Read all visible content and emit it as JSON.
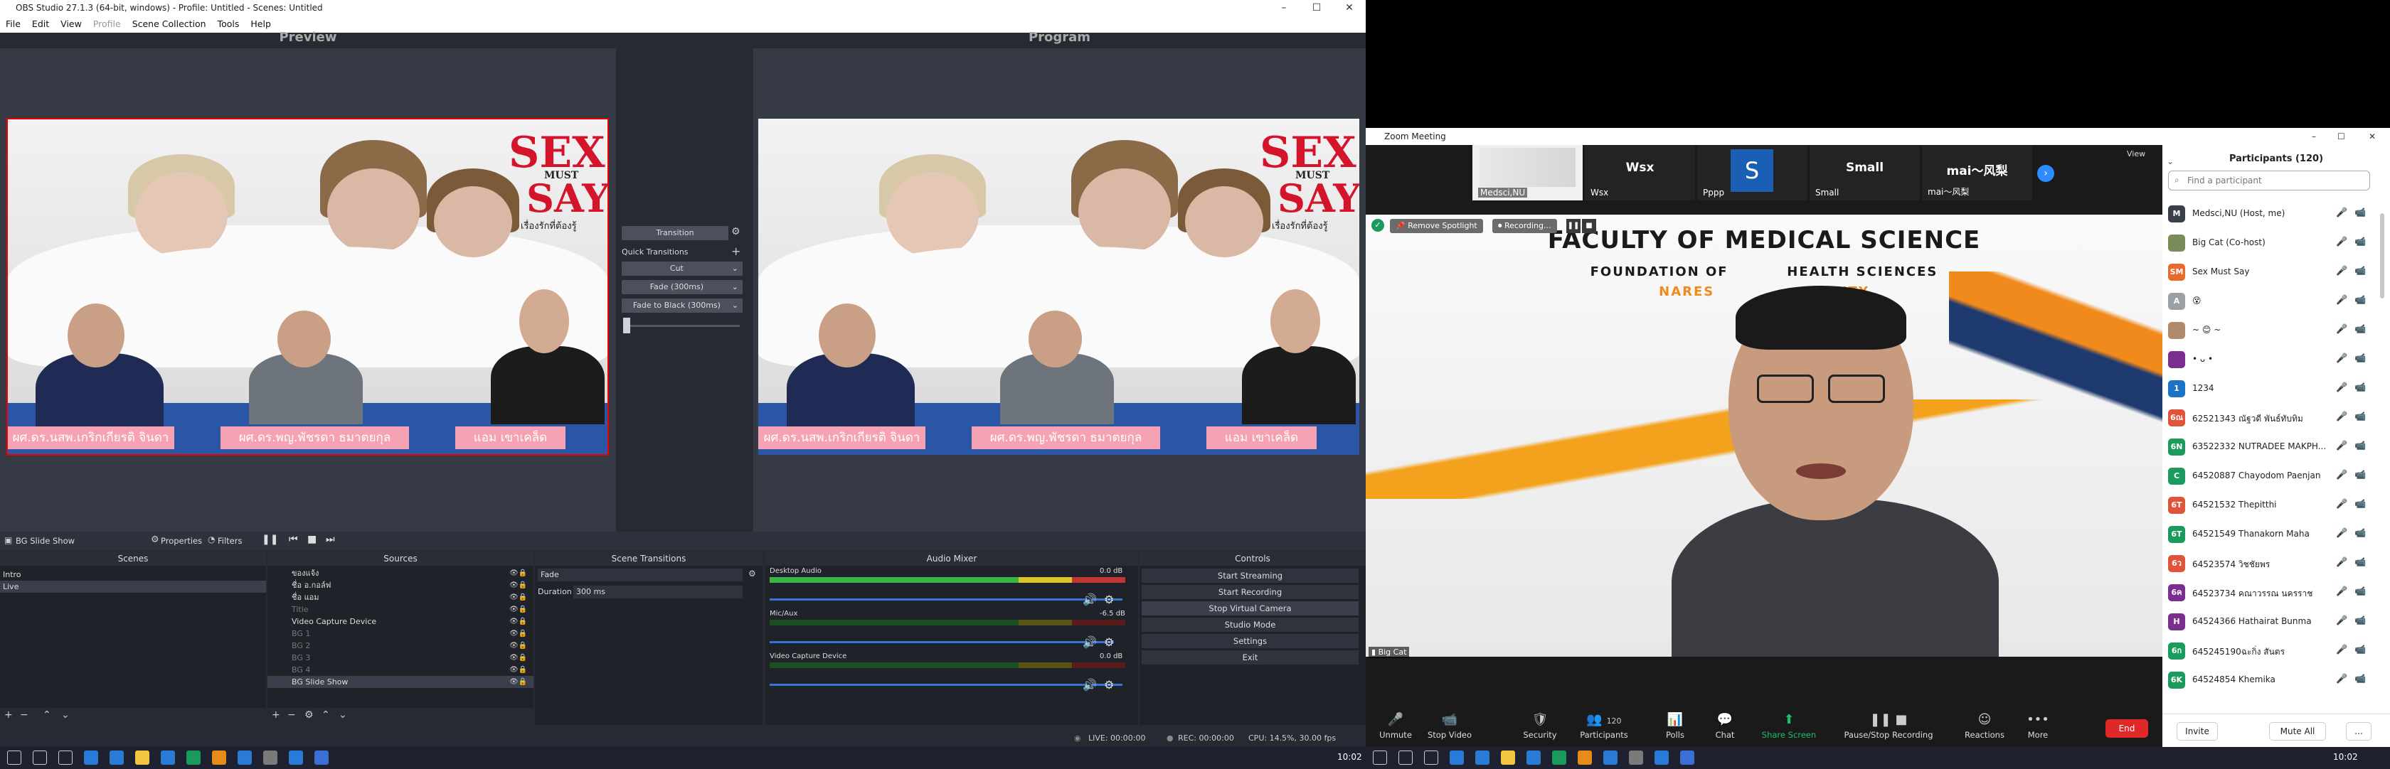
{
  "obs": {
    "title": "OBS Studio 27.1.3 (64-bit, windows) - Profile: Untitled - Scenes: Untitled",
    "menu": [
      "File",
      "Edit",
      "View",
      "Profile",
      "Scene Collection",
      "Tools",
      "Help"
    ],
    "preview_label": "Preview",
    "program_label": "Program",
    "scene_logo": {
      "line1": "SEX",
      "line2": "MUST",
      "line3": "SAY",
      "tagline": "เรื่องรักที่ต้องรู้"
    },
    "name_plates": [
      "ผศ.ดร.นสพ.เกริกเกียรติ จินดา",
      "ผศ.ดร.พญ.พัชรดา ธมาตยกุล",
      "แอม เขาเคล็ด"
    ],
    "transition": {
      "button": "Transition",
      "quick_label": "Quick Transitions",
      "options": [
        "Cut",
        "Fade (300ms)",
        "Fade to Black (300ms)"
      ]
    },
    "source_toolbar": {
      "source": "BG Slide Show",
      "properties": "Properties",
      "filters": "Filters"
    },
    "docks": {
      "scenes": {
        "title": "Scenes",
        "items": [
          "Intro",
          "Live"
        ],
        "selected": 1
      },
      "sources": {
        "title": "Sources",
        "items": [
          "ของแจ้ง",
          "ชื่อ อ.กอล์ฟ",
          "ชื่อ แอม",
          "Title",
          "Video Capture Device",
          "BG 1",
          "BG 2",
          "BG 3",
          "BG 4",
          "BG Slide Show"
        ]
      },
      "transitions": {
        "title": "Scene Transitions",
        "selected": "Fade",
        "duration_label": "Duration",
        "duration": "300 ms"
      },
      "mixer": {
        "title": "Audio Mixer",
        "channels": [
          {
            "name": "Desktop Audio",
            "db": "0.0 dB",
            "level": 0.78,
            "volume": 0.98
          },
          {
            "name": "Mic/Aux",
            "db": "-6.5 dB",
            "level": 0.0,
            "volume": 0.95
          },
          {
            "name": "Video Capture Device",
            "db": "0.0 dB",
            "level": 0.0,
            "volume": 0.98
          }
        ]
      },
      "controls": {
        "title": "Controls",
        "buttons": [
          "Start Streaming",
          "Start Recording",
          "Stop Virtual Camera",
          "Studio Mode",
          "Settings",
          "Exit"
        ]
      }
    },
    "status": {
      "live": "LIVE: 00:00:00",
      "rec": "REC: 00:00:00",
      "cpu": "CPU: 14.5%, 30.00 fps"
    }
  },
  "zoom": {
    "title": "Zoom Meeting",
    "view_label": "View",
    "tiles": [
      {
        "name": "Medsci,NU",
        "big": ""
      },
      {
        "name": "Wsx",
        "big": "Wsx"
      },
      {
        "name": "Pppp",
        "big": "S"
      },
      {
        "name": "Small",
        "big": "Small"
      },
      {
        "name": "mai～风梨",
        "big": "mai～风梨"
      }
    ],
    "spotlight": "Remove Spotlight",
    "recording": "Recording...",
    "speaker_name": "Big Cat",
    "slide": {
      "line1": "FACULTY OF MEDICAL SCIENCE",
      "line2": "FOUNDATION OF          HEALTH SCIENCES",
      "line3": "NARES                  RSITY"
    },
    "toolbar": [
      "Unmute",
      "Stop Video",
      "Security",
      "Participants",
      "Polls",
      "Chat",
      "Share Screen",
      "Pause/Stop Recording",
      "Reactions",
      "More"
    ],
    "participant_count_badge": "120",
    "end_label": "End",
    "participants": {
      "title": "Participants (120)",
      "search_placeholder": "Find a participant",
      "list": [
        {
          "avatar": "M",
          "name": "Medsci,NU (Host, me)",
          "color": "#3b3f4a"
        },
        {
          "avatar": "",
          "name": "Big Cat (Co-host)",
          "color": "#7c8b5a"
        },
        {
          "avatar": "SM",
          "name": "Sex Must Say",
          "color": "#e86a2c"
        },
        {
          "avatar": "A",
          "name": "😵",
          "color": "#9aa0a6"
        },
        {
          "avatar": "",
          "name": "~ 😊 ~",
          "color": "#b08a6a"
        },
        {
          "avatar": "",
          "name": "• ᴗ •",
          "color": "#7a2f8f"
        },
        {
          "avatar": "1",
          "name": "1234",
          "color": "#1a73c7"
        },
        {
          "avatar": "6ณ",
          "name": "62521343 ณัฐวดี พันธ์ทับทิม",
          "color": "#e0553a"
        },
        {
          "avatar": "6N",
          "name": "63522332 NUTRADEE MAKPH...",
          "color": "#1a9a5c"
        },
        {
          "avatar": "C",
          "name": "64520887 Chayodom Paenjan",
          "color": "#1a9a5c"
        },
        {
          "avatar": "6T",
          "name": "64521532 Thepitthi",
          "color": "#e0553a"
        },
        {
          "avatar": "6T",
          "name": "64521549 Thanakorn Maha",
          "color": "#1a9a5c"
        },
        {
          "avatar": "6ว",
          "name": "64523574 วิชชัยพร",
          "color": "#e0553a"
        },
        {
          "avatar": "6ค",
          "name": "64523734 คณาวรรณ นครราช",
          "color": "#7a2f8f"
        },
        {
          "avatar": "H",
          "name": "64524366 Hathairat Bunma",
          "color": "#7a2f8f"
        },
        {
          "avatar": "6ก",
          "name": "645245190ฉะกิ่ง สันตร",
          "color": "#1a9a5c"
        },
        {
          "avatar": "6K",
          "name": "64524854 Khemika",
          "color": "#1a9a5c"
        }
      ],
      "invite": "Invite",
      "mute_all": "Mute All",
      "more": "..."
    }
  },
  "taskbar": {
    "clock_left": "10:02",
    "clock_right": "10:02"
  }
}
